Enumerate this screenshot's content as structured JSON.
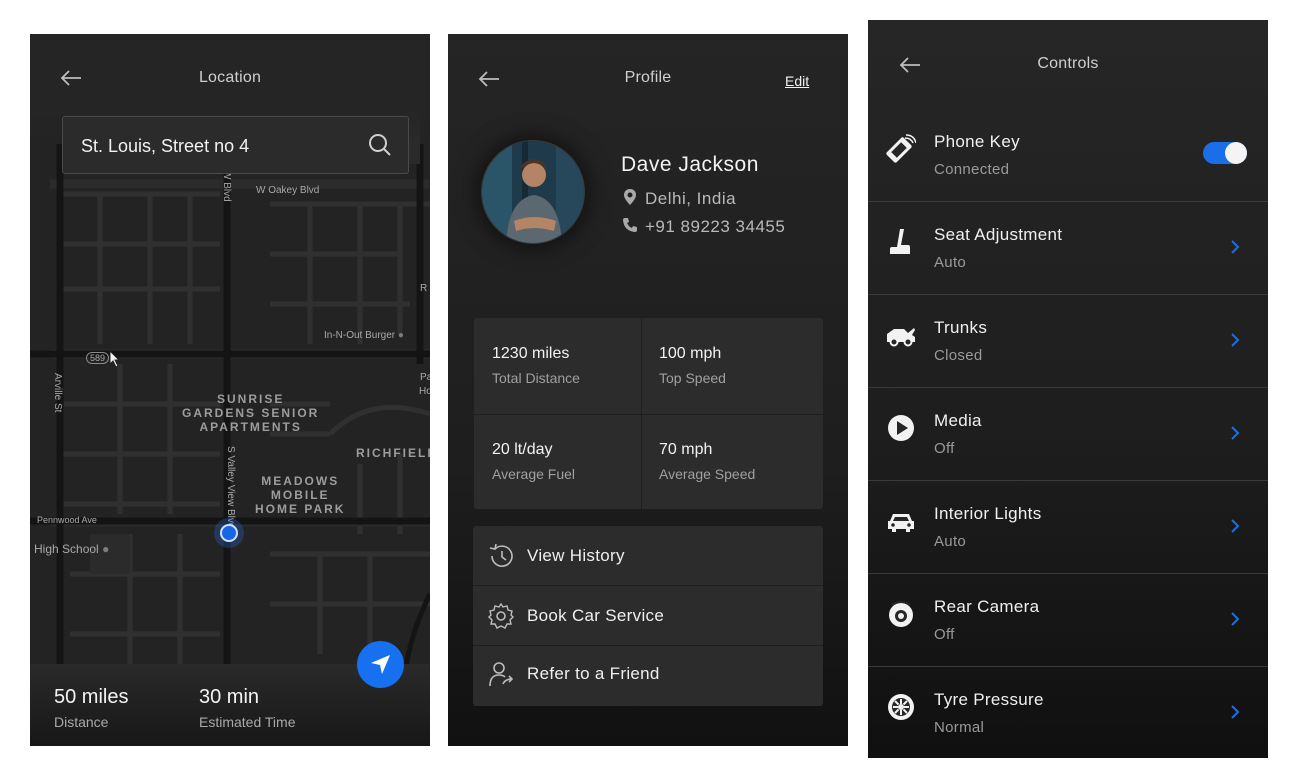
{
  "location": {
    "title": "Location",
    "search_value": "St. Louis, Street no 4",
    "map_labels": {
      "oakey": "W Oakey Blvd",
      "wblvd": "W Blvd",
      "innout": "In-N-Out Burger",
      "route": "589",
      "arville": "Arville St",
      "sunrise": "SUNRISE\nGARDENS SENIOR\nAPARTMENTS",
      "meadows": "MEADOWS\nMOBILE\nHOME PARK",
      "richfield": "RICHFIELD",
      "svalley": "S Valley View Blvd",
      "pennwood": "Pennwood Ave",
      "highschool": "High School",
      "edge_r": "R",
      "edge_pa": "Pa",
      "edge_ho": "Ho"
    },
    "distance_value": "50 miles",
    "distance_label": "Distance",
    "time_value": "30 min",
    "time_label": "Estimated Time"
  },
  "profile": {
    "title": "Profile",
    "edit_label": "Edit",
    "name": "Dave Jackson",
    "city": "Delhi, India",
    "phone": "+91 89223 34455",
    "stats": [
      {
        "value": "1230 miles",
        "label": "Total Distance"
      },
      {
        "value": "100 mph",
        "label": "Top Speed"
      },
      {
        "value": "20 lt/day",
        "label": "Average Fuel"
      },
      {
        "value": "70 mph",
        "label": "Average Speed"
      }
    ],
    "actions": [
      {
        "label": "View History",
        "icon": "history-icon"
      },
      {
        "label": "Book Car Service",
        "icon": "gear-icon"
      },
      {
        "label": "Refer to a Friend",
        "icon": "refer-friend-icon"
      }
    ]
  },
  "controls": {
    "title": "Controls",
    "items": [
      {
        "label": "Phone Key",
        "status": "Connected",
        "icon": "phone-key-icon",
        "toggle_on": true
      },
      {
        "label": "Seat Adjustment",
        "status": "Auto",
        "icon": "seat-icon"
      },
      {
        "label": "Trunks",
        "status": "Closed",
        "icon": "trunk-icon"
      },
      {
        "label": "Media",
        "status": "Off",
        "icon": "play-icon"
      },
      {
        "label": "Interior Lights",
        "status": "Auto",
        "icon": "car-icon"
      },
      {
        "label": "Rear Camera",
        "status": "Off",
        "icon": "camera-icon"
      },
      {
        "label": "Tyre Pressure",
        "status": "Normal",
        "icon": "tyre-icon"
      }
    ]
  },
  "colors": {
    "accent": "#1670f0",
    "background": "#232323",
    "panel": "#2c2c2c"
  }
}
